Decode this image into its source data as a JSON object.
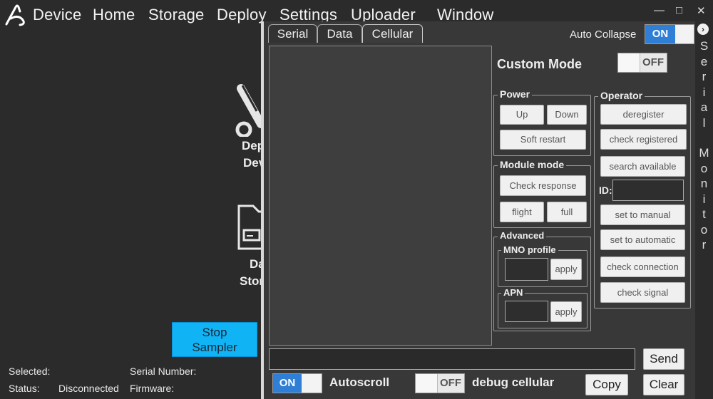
{
  "menu": {
    "items": [
      "Device",
      "Home",
      "Storage",
      "Deploy",
      "Settings",
      "Uploader",
      "Window"
    ],
    "window_controls": [
      "—",
      "□",
      "✕"
    ]
  },
  "background": {
    "tile1_label_line1": "Dep",
    "tile1_label_line2": "Dev",
    "tile2_label_line1": "Da",
    "tile2_label_line2": "Stor",
    "stop_button": {
      "line1": "Stop",
      "line2": "Sampler"
    },
    "status": {
      "selected_label": "Selected:",
      "serial_number_label": "Serial Number:",
      "status_label": "Status:",
      "status_value": "Disconnected",
      "firmware_label": "Firmware:"
    }
  },
  "serial_panel": {
    "tabs": [
      {
        "label": "Serial",
        "active": false
      },
      {
        "label": "Data",
        "active": false
      },
      {
        "label": "Cellular",
        "active": true
      }
    ],
    "auto_collapse": {
      "label": "Auto Collapse",
      "state": "ON"
    },
    "collapse_icon": "chevron-right-icon",
    "side_title": "Serial Monitor",
    "custom_mode": {
      "label": "Custom Mode",
      "state": "OFF"
    },
    "power": {
      "title": "Power",
      "up": "Up",
      "down": "Down",
      "soft_restart": "Soft restart"
    },
    "module_mode": {
      "title": "Module mode",
      "check_response": "Check response",
      "flight": "flight",
      "full": "full"
    },
    "advanced": {
      "title": "Advanced",
      "mno_profile": {
        "title": "MNO profile",
        "value": "",
        "apply": "apply"
      },
      "apn": {
        "title": "APN",
        "value": "",
        "apply": "apply"
      }
    },
    "operator": {
      "title": "Operator",
      "deregister": "deregister",
      "check_registered": "check registered",
      "search_available": "search available",
      "id_label": "ID:",
      "id_value": "",
      "set_to_manual": "set to manual",
      "set_to_automatic": "set to automatic",
      "check_connection": "check connection",
      "check_signal": "check signal"
    },
    "send_input": "",
    "send_button": "Send",
    "autoscroll": {
      "label": "Autoscroll",
      "state": "ON"
    },
    "debug_cellular": {
      "label": "debug cellular",
      "state": "OFF"
    },
    "copy_button": "Copy",
    "clear_button": "Clear"
  },
  "colors": {
    "background": "#2b2b2b",
    "panel": "#383838",
    "toggle_on": "#2f7fd6",
    "stop_button": "#10b4f5"
  }
}
